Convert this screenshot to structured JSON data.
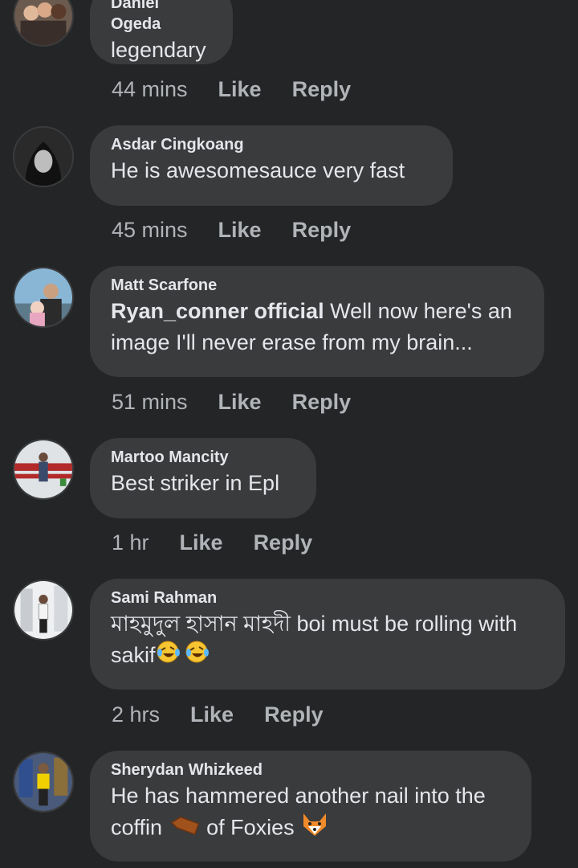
{
  "comments": [
    {
      "author": "Daniel Ogeda",
      "text": "legendary",
      "time": "44 mins",
      "like": "Like",
      "reply": "Reply"
    },
    {
      "author": "Asdar Cingkoang",
      "text": "He is awesomesauce very fast",
      "time": "45 mins",
      "like": "Like",
      "reply": "Reply"
    },
    {
      "author": "Matt Scarfone",
      "mention": "Ryan_conner official",
      "text": "Well now here's an",
      "text2": "image I'll never erase from my brain...",
      "time": "51 mins",
      "like": "Like",
      "reply": "Reply"
    },
    {
      "author": "Martoo Mancity",
      "text": "Best striker in Epl",
      "time": "1 hr",
      "like": "Like",
      "reply": "Reply"
    },
    {
      "author": "Sami Rahman",
      "text": "মাহমুদুল হাসান মাহদী boi must be rolling with",
      "text2": "sakif",
      "emoji": "rofl-emoji",
      "time": "2 hrs",
      "like": "Like",
      "reply": "Reply"
    },
    {
      "author": "Sherydan Whizkeed",
      "text": "He has hammered another nail into the",
      "text2": "coffin",
      "text3": "of Foxies",
      "emoji1": "coffin-emoji",
      "emoji2": "fox-emoji"
    }
  ],
  "colors": {
    "background": "#242526",
    "bubble": "#3a3b3c",
    "meta": "#b0b3b8",
    "text": "#e4e6eb"
  }
}
